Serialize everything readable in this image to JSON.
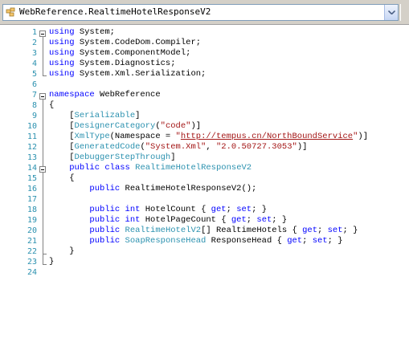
{
  "navbar": {
    "type_selector_value": "WebReference.RealtimeHotelResponseV2"
  },
  "editor": {
    "lines": [
      {
        "n": "1",
        "tokens": [
          {
            "t": "using",
            "c": "kw"
          },
          {
            "t": " System;",
            "c": ""
          }
        ]
      },
      {
        "n": "2",
        "tokens": [
          {
            "t": "using",
            "c": "kw"
          },
          {
            "t": " System.CodeDom.Compiler;",
            "c": ""
          }
        ]
      },
      {
        "n": "3",
        "tokens": [
          {
            "t": "using",
            "c": "kw"
          },
          {
            "t": " System.ComponentModel;",
            "c": ""
          }
        ]
      },
      {
        "n": "4",
        "tokens": [
          {
            "t": "using",
            "c": "kw"
          },
          {
            "t": " System.Diagnostics;",
            "c": ""
          }
        ]
      },
      {
        "n": "5",
        "tokens": [
          {
            "t": "using",
            "c": "kw"
          },
          {
            "t": " System.Xml.Serialization;",
            "c": ""
          }
        ]
      },
      {
        "n": "6",
        "tokens": []
      },
      {
        "n": "7",
        "tokens": [
          {
            "t": "namespace",
            "c": "kw"
          },
          {
            "t": " WebReference",
            "c": ""
          }
        ]
      },
      {
        "n": "8",
        "tokens": [
          {
            "t": "{",
            "c": ""
          }
        ]
      },
      {
        "n": "9",
        "tokens": [
          {
            "t": "    [",
            "c": ""
          },
          {
            "t": "Serializable",
            "c": "ty"
          },
          {
            "t": "]",
            "c": ""
          }
        ]
      },
      {
        "n": "10",
        "tokens": [
          {
            "t": "    [",
            "c": ""
          },
          {
            "t": "DesignerCategory",
            "c": "ty"
          },
          {
            "t": "(",
            "c": ""
          },
          {
            "t": "\"code\"",
            "c": "str"
          },
          {
            "t": ")]",
            "c": ""
          }
        ]
      },
      {
        "n": "11",
        "tokens": [
          {
            "t": "    [",
            "c": ""
          },
          {
            "t": "XmlType",
            "c": "ty"
          },
          {
            "t": "(Namespace = ",
            "c": ""
          },
          {
            "t": "\"",
            "c": "str"
          },
          {
            "t": "http://tempus.cn/NorthBoundService",
            "c": "url"
          },
          {
            "t": "\"",
            "c": "str"
          },
          {
            "t": ")]",
            "c": ""
          }
        ]
      },
      {
        "n": "12",
        "tokens": [
          {
            "t": "    [",
            "c": ""
          },
          {
            "t": "GeneratedCode",
            "c": "ty"
          },
          {
            "t": "(",
            "c": ""
          },
          {
            "t": "\"System.Xml\"",
            "c": "str"
          },
          {
            "t": ", ",
            "c": ""
          },
          {
            "t": "\"2.0.50727.3053\"",
            "c": "str"
          },
          {
            "t": ")]",
            "c": ""
          }
        ]
      },
      {
        "n": "13",
        "tokens": [
          {
            "t": "    [",
            "c": ""
          },
          {
            "t": "DebuggerStepThrough",
            "c": "ty"
          },
          {
            "t": "]",
            "c": ""
          }
        ]
      },
      {
        "n": "14",
        "tokens": [
          {
            "t": "    ",
            "c": ""
          },
          {
            "t": "public",
            "c": "kw"
          },
          {
            "t": " ",
            "c": ""
          },
          {
            "t": "class",
            "c": "kw"
          },
          {
            "t": " ",
            "c": ""
          },
          {
            "t": "RealtimeHotelResponseV2",
            "c": "ty"
          }
        ]
      },
      {
        "n": "15",
        "tokens": [
          {
            "t": "    {",
            "c": ""
          }
        ]
      },
      {
        "n": "16",
        "tokens": [
          {
            "t": "        ",
            "c": ""
          },
          {
            "t": "public",
            "c": "kw"
          },
          {
            "t": " RealtimeHotelResponseV2();",
            "c": ""
          }
        ]
      },
      {
        "n": "17",
        "tokens": []
      },
      {
        "n": "18",
        "tokens": [
          {
            "t": "        ",
            "c": ""
          },
          {
            "t": "public",
            "c": "kw"
          },
          {
            "t": " ",
            "c": ""
          },
          {
            "t": "int",
            "c": "kw"
          },
          {
            "t": " HotelCount { ",
            "c": ""
          },
          {
            "t": "get",
            "c": "kw"
          },
          {
            "t": "; ",
            "c": ""
          },
          {
            "t": "set",
            "c": "kw"
          },
          {
            "t": "; }",
            "c": ""
          }
        ]
      },
      {
        "n": "19",
        "tokens": [
          {
            "t": "        ",
            "c": ""
          },
          {
            "t": "public",
            "c": "kw"
          },
          {
            "t": " ",
            "c": ""
          },
          {
            "t": "int",
            "c": "kw"
          },
          {
            "t": " HotelPageCount { ",
            "c": ""
          },
          {
            "t": "get",
            "c": "kw"
          },
          {
            "t": "; ",
            "c": ""
          },
          {
            "t": "set",
            "c": "kw"
          },
          {
            "t": "; }",
            "c": ""
          }
        ]
      },
      {
        "n": "20",
        "tokens": [
          {
            "t": "        ",
            "c": ""
          },
          {
            "t": "public",
            "c": "kw"
          },
          {
            "t": " ",
            "c": ""
          },
          {
            "t": "RealtimeHotelV2",
            "c": "ty"
          },
          {
            "t": "[] RealtimeHotels { ",
            "c": ""
          },
          {
            "t": "get",
            "c": "kw"
          },
          {
            "t": "; ",
            "c": ""
          },
          {
            "t": "set",
            "c": "kw"
          },
          {
            "t": "; }",
            "c": ""
          }
        ]
      },
      {
        "n": "21",
        "tokens": [
          {
            "t": "        ",
            "c": ""
          },
          {
            "t": "public",
            "c": "kw"
          },
          {
            "t": " ",
            "c": ""
          },
          {
            "t": "SoapResponseHead",
            "c": "ty"
          },
          {
            "t": " ResponseHead { ",
            "c": ""
          },
          {
            "t": "get",
            "c": "kw"
          },
          {
            "t": "; ",
            "c": ""
          },
          {
            "t": "set",
            "c": "kw"
          },
          {
            "t": "; }",
            "c": ""
          }
        ]
      },
      {
        "n": "22",
        "tokens": [
          {
            "t": "    }",
            "c": ""
          }
        ]
      },
      {
        "n": "23",
        "tokens": [
          {
            "t": "}",
            "c": ""
          }
        ]
      },
      {
        "n": "24",
        "tokens": []
      }
    ]
  }
}
